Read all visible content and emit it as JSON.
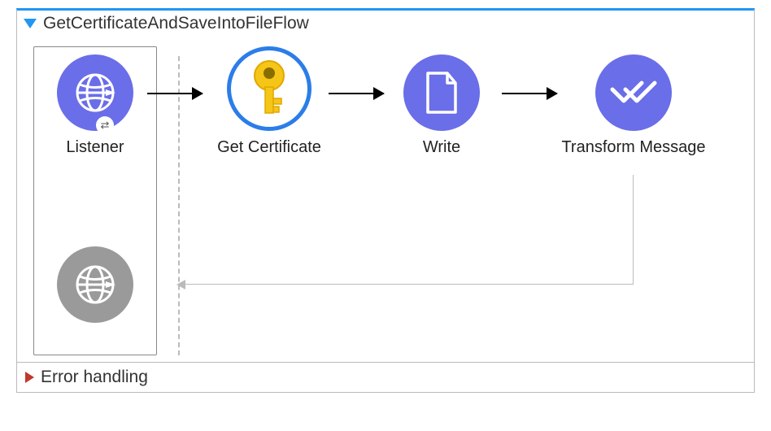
{
  "flow": {
    "title": "GetCertificateAndSaveIntoFileFlow",
    "nodes": {
      "listener": {
        "label": "Listener"
      },
      "getCert": {
        "label": "Get Certificate"
      },
      "write": {
        "label": "Write"
      },
      "transform": {
        "label": "Transform Message"
      }
    }
  },
  "error": {
    "title": "Error handling"
  },
  "colors": {
    "accent": "#6a6ee8",
    "ring": "#2b7de9",
    "topBorder": "#2196f3"
  }
}
